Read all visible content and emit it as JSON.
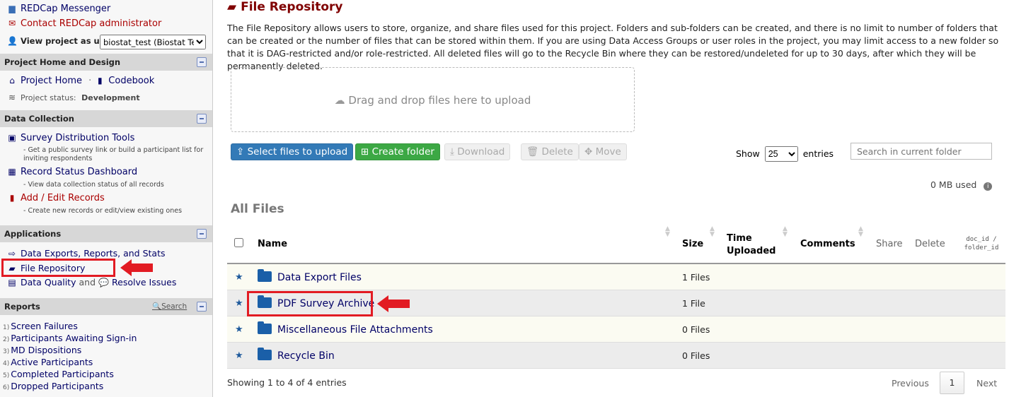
{
  "sidebar": {
    "messenger": "REDCap Messenger",
    "contact_admin": "Contact REDCap administrator",
    "view_as_label": "View project as user:",
    "view_as_value": "biostat_test (Biostat Tes",
    "sections": {
      "home": {
        "title": "Project Home and Design",
        "project_home": "Project Home",
        "sep": "·",
        "codebook": "Codebook",
        "status_label": "Project status:",
        "status_value": "Development"
      },
      "collection": {
        "title": "Data Collection",
        "items": [
          {
            "label": "Survey Distribution Tools",
            "desc": "- Get a public survey link or build a participant list for inviting respondents"
          },
          {
            "label": "Record Status Dashboard",
            "desc": "- View data collection status of all records"
          },
          {
            "label": "Add / Edit Records",
            "desc": "- Create new records or edit/view existing ones"
          }
        ]
      },
      "applications": {
        "title": "Applications",
        "items": [
          "Data Exports, Reports, and Stats",
          "File Repository"
        ],
        "dq": "Data Quality",
        "and": "and",
        "resolve": "Resolve Issues"
      },
      "reports": {
        "title": "Reports",
        "search": "Search",
        "items": [
          {
            "num": "1)",
            "label": "Screen Failures"
          },
          {
            "num": "2)",
            "label": "Participants Awaiting Sign-in"
          },
          {
            "num": "3)",
            "label": "MD Dispositions"
          },
          {
            "num": "4)",
            "label": "Active Participants"
          },
          {
            "num": "5)",
            "label": "Completed Participants"
          },
          {
            "num": "6)",
            "label": "Dropped Participants"
          }
        ]
      }
    }
  },
  "main": {
    "title": "File Repository",
    "intro": "The File Repository allows users to store, organize, and share files used for this project. Folders and sub-folders can be created, and there is no limit to number of folders that can be created or the number of files that can be stored within them. If you are using Data Access Groups or user roles in the project, you may limit access to a new folder so that it is DAG-restricted and/or role-restricted. All deleted files will go to the Recycle Bin where they can be restored/undeleted for up to 30 days, after which they will be permanently deleted.",
    "dropzone": "Drag and drop files here to upload",
    "buttons": {
      "select": "Select files to upload",
      "create": "Create folder",
      "download": "Download",
      "delete": "Delete",
      "move": "Move"
    },
    "show": "Show",
    "entries_value": "25",
    "entries": "entries",
    "search_placeholder": "Search in current folder",
    "usage": "0 MB used",
    "heading": "All Files",
    "columns": {
      "name": "Name",
      "size": "Size",
      "time": "Time Uploaded",
      "comments": "Comments",
      "share": "Share",
      "delete": "Delete",
      "docid": "doc_id / folder_id"
    },
    "rows": [
      {
        "name": "Data Export Files",
        "size": "1 Files"
      },
      {
        "name": "PDF Survey Archive",
        "size": "1 File"
      },
      {
        "name": "Miscellaneous File Attachments",
        "size": "0 Files"
      },
      {
        "name": "Recycle Bin",
        "size": "0 Files"
      }
    ],
    "showing": "Showing 1 to 4 of 4 entries",
    "pager": {
      "prev": "Previous",
      "page": "1",
      "next": "Next"
    }
  },
  "colors": {
    "accent": "#800000",
    "primary": "#337ab7",
    "success": "#3ca844",
    "annotation": "#e21b23"
  }
}
